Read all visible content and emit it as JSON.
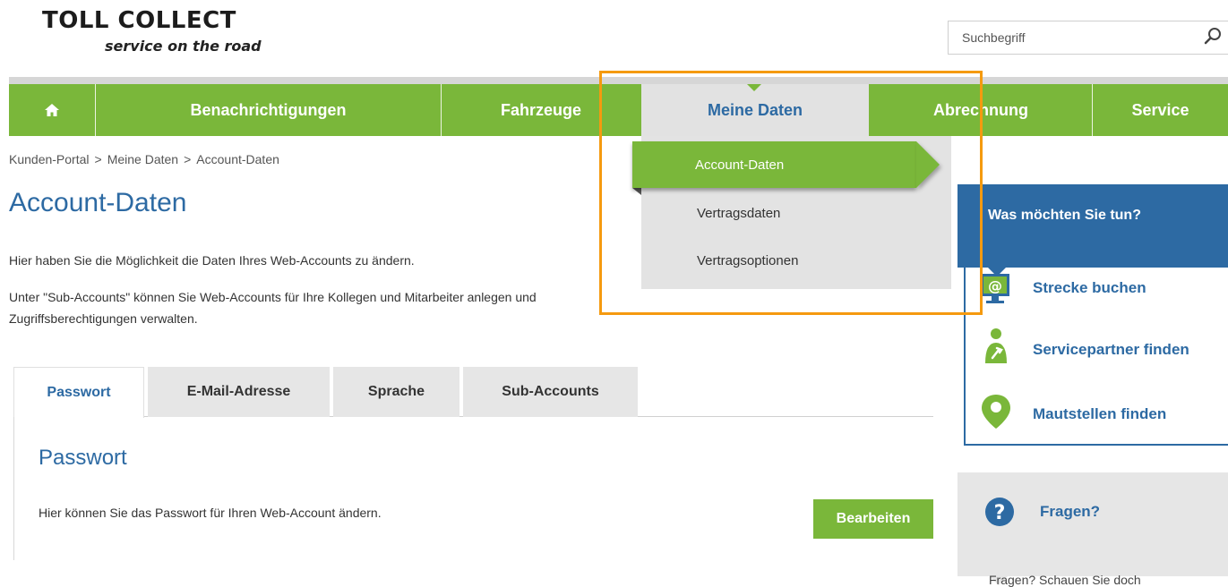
{
  "logo": {
    "name": "TOLL COLLECT",
    "tagline": "service on the road"
  },
  "search": {
    "placeholder": "Suchbegriff",
    "icon": "search-icon"
  },
  "nav": {
    "home_icon": "home-icon",
    "items": [
      {
        "label": "Benachrichtigungen"
      },
      {
        "label": "Fahrzeuge"
      },
      {
        "label": "Meine Daten",
        "active": true
      },
      {
        "label": "Abrechnung"
      },
      {
        "label": "Service"
      }
    ]
  },
  "dropdown": {
    "items": [
      {
        "label": "Account-Daten",
        "active": true
      },
      {
        "label": "Vertragsdaten"
      },
      {
        "label": "Vertragsoptionen"
      }
    ]
  },
  "breadcrumb": [
    "Kunden-Portal",
    "Meine Daten",
    "Account-Daten"
  ],
  "breadcrumb_separator": ">",
  "page": {
    "title": "Account-Daten",
    "intro1": "Hier haben Sie die Möglichkeit die Daten Ihres Web-Accounts zu ändern.",
    "intro2": "Unter \"Sub-Accounts\" können Sie Web-Accounts für Ihre Kollegen und Mitarbeiter anlegen und Zugriffsberechtigungen verwalten."
  },
  "tabs": [
    {
      "label": "Passwort",
      "active": true
    },
    {
      "label": "E-Mail-Adresse"
    },
    {
      "label": "Sprache"
    },
    {
      "label": "Sub-Accounts"
    }
  ],
  "password_section": {
    "title": "Passwort",
    "text": "Hier können Sie das Passwort für Ihren Web-Account ändern.",
    "button": "Bearbeiten"
  },
  "sidebar": {
    "title": "Was möchten Sie tun?",
    "actions": [
      {
        "label": "Strecke buchen",
        "icon": "monitor-at-icon"
      },
      {
        "label": "Servicepartner finden",
        "icon": "service-person-icon"
      },
      {
        "label": "Mautstellen finden",
        "icon": "location-pin-icon"
      }
    ],
    "questions": {
      "title": "Fragen?",
      "icon": "question-icon",
      "teaser": "Fragen? Schauen Sie doch"
    }
  },
  "colors": {
    "green": "#7ab73a",
    "blue": "#2d6aa3",
    "highlight": "#f59a0f",
    "light_gray": "#e3e3e3"
  }
}
